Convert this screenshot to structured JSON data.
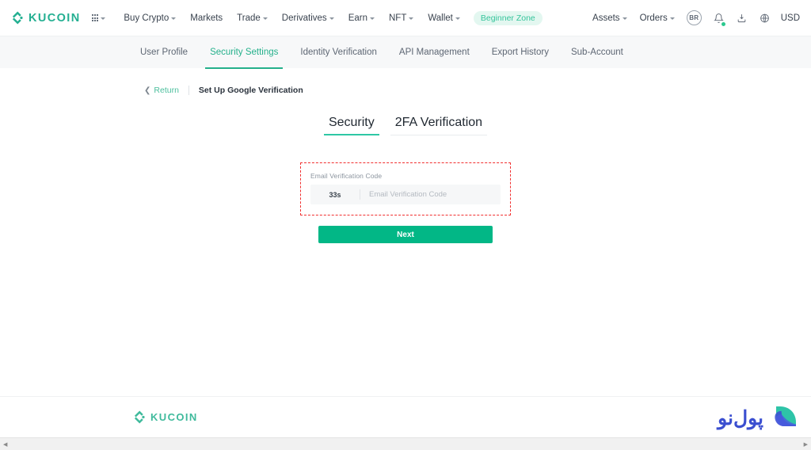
{
  "header": {
    "brand": "KUCOIN",
    "apps_icon": "grid-apps-icon",
    "nav": [
      {
        "label": "Buy Crypto",
        "caret": true
      },
      {
        "label": "Markets",
        "caret": false
      },
      {
        "label": "Trade",
        "caret": true
      },
      {
        "label": "Derivatives",
        "caret": true
      },
      {
        "label": "Earn",
        "caret": true
      },
      {
        "label": "NFT",
        "caret": true
      },
      {
        "label": "Wallet",
        "caret": true
      }
    ],
    "beginner_zone": "Beginner Zone",
    "right": {
      "assets": "Assets",
      "orders": "Orders",
      "avatar_initials": "BR",
      "bell_icon": "notification-bell-icon",
      "has_notification": true,
      "download_icon": "download-app-icon",
      "globe_icon": "language-globe-icon",
      "currency": "USD"
    }
  },
  "subnav": {
    "items": [
      {
        "label": "User Profile",
        "active": false
      },
      {
        "label": "Security Settings",
        "active": true
      },
      {
        "label": "Identity Verification",
        "active": false
      },
      {
        "label": "API Management",
        "active": false
      },
      {
        "label": "Export History",
        "active": false
      },
      {
        "label": "Sub-Account",
        "active": false
      }
    ]
  },
  "breadcrumb": {
    "chevron_icon": "chevron-left-icon",
    "return_label": "Return",
    "current": "Set Up Google Verification"
  },
  "main": {
    "tabs": [
      {
        "label": "Security",
        "active": true
      },
      {
        "label": "2FA Verification",
        "active": false
      }
    ],
    "form": {
      "field_label": "Email Verification Code",
      "countdown": "33s",
      "input_placeholder": "Email Verification Code",
      "input_value": "",
      "highlight_color": "#f12f2f"
    },
    "next_button": "Next"
  },
  "footer": {
    "brand": "KUCOIN"
  },
  "watermark": {
    "text": "پول‌نو",
    "logo_icon": "pooleno-leaf-logo"
  },
  "scrollbar": {
    "left_arrow": "◀",
    "right_arrow": "▶"
  },
  "colors": {
    "accent_green": "#02b786",
    "brand_green": "#23af91",
    "highlight_red": "#f12f2f",
    "watermark_blue": "#3b4fd0"
  }
}
